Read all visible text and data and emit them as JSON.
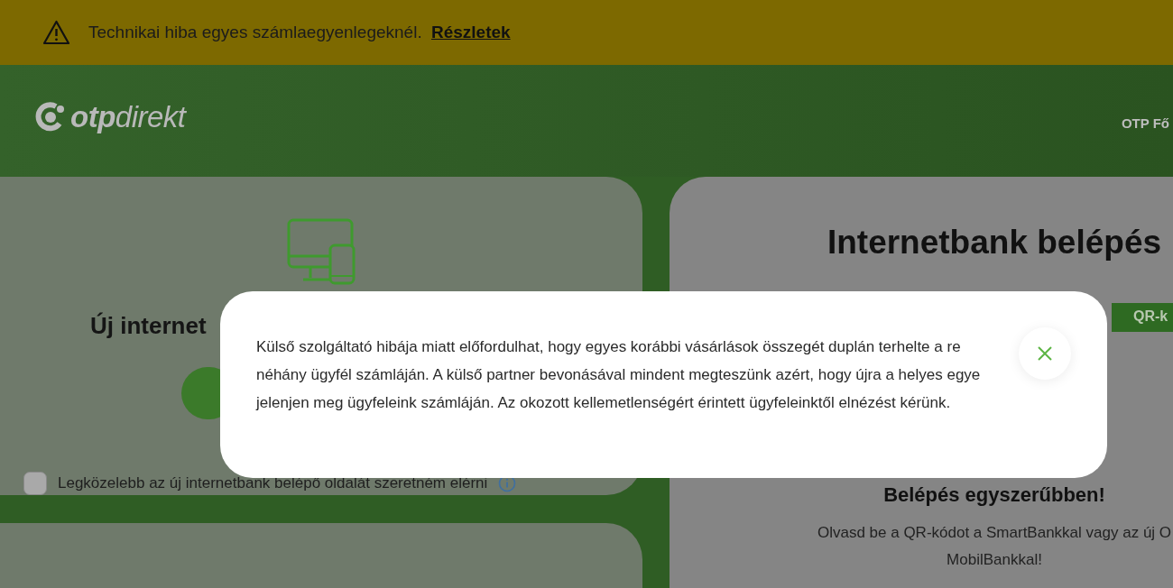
{
  "alert_banner": {
    "message": "Technikai hiba egyes számlaegyenlegeknél.",
    "link": "Részletek"
  },
  "header": {
    "logo": "**otp**direkt",
    "nav_items": [
      "OTP Fő"
    ]
  },
  "new_internetbank_card": {
    "title": "Új internet",
    "checkbox": {
      "label": "Legközelebb az új internetbank belépő oldalát szeretném elérni",
      "checked": false
    }
  },
  "login_card": {
    "title": "Internetbank belépés",
    "tabs": [
      {
        "label": "QR-k",
        "selected": true
      }
    ],
    "subtitle": "Belépés egyszerűbben!",
    "description_lines": [
      "Olvasd be a QR-kódot a SmartBankkal vagy az új O",
      "MobilBankkal!"
    ]
  },
  "modal": {
    "lines": [
      "Külső szolgáltató hibája miatt előfordulhat, hogy egyes korábbi vásárlások összegét duplán terhelte a re",
      "néhány ügyfél számláján. A külső partner bevonásával mindent megteszünk azért, hogy újra a helyes egye",
      "jelenjen meg ügyfeleink számláján. Az okozott kellemetlenségért érintett ügyfeleinktől elnézést kérünk."
    ]
  }
}
